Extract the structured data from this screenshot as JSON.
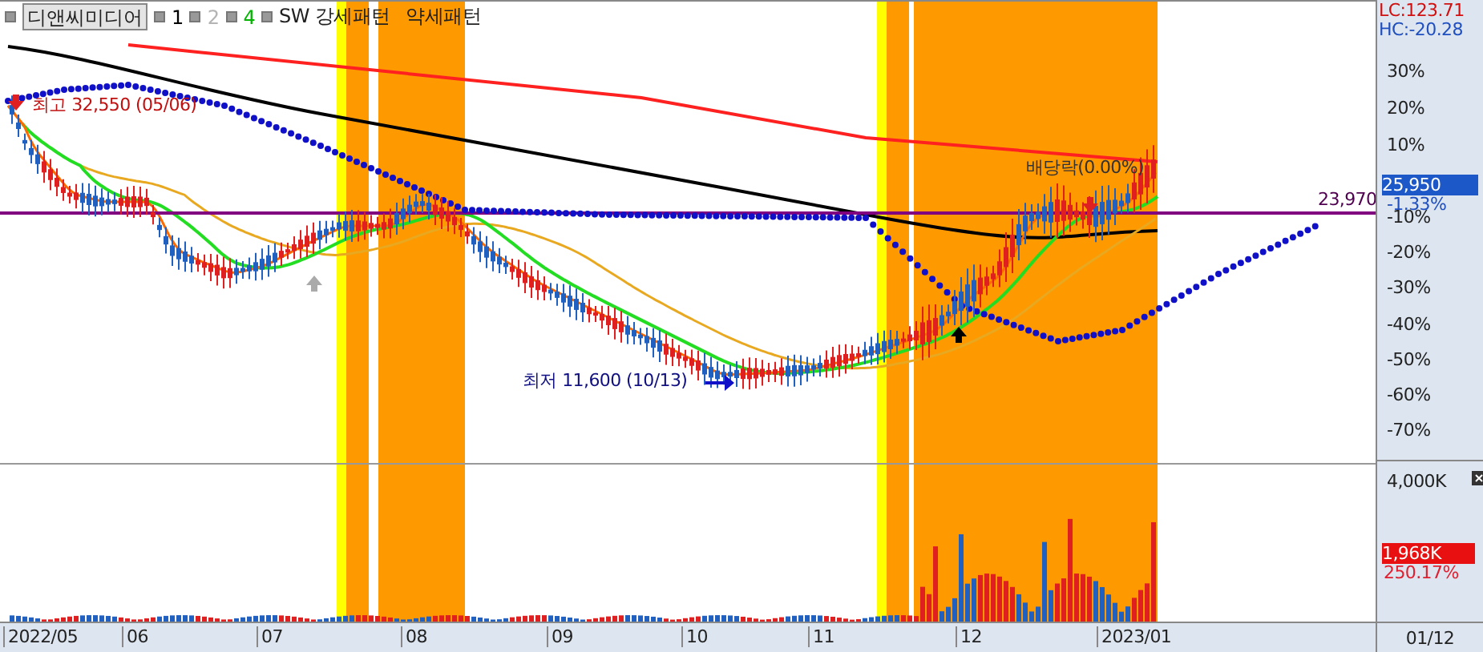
{
  "header": {
    "stock_button": "디앤씨미디어",
    "legend": [
      {
        "label": "1",
        "color": "#000000"
      },
      {
        "label": "2",
        "color": "#b4b4b4"
      },
      {
        "label": "4",
        "color": "#00b400"
      },
      {
        "label": "SW 강세패턴",
        "color": "#202020"
      }
    ],
    "extra_label": "약세패턴"
  },
  "annotations": {
    "high": "최고 32,550 (05/06)",
    "low": "최저 11,600 (10/13)",
    "dividend": "배당락(0.00%)",
    "line_value": "23,970"
  },
  "price_axis": {
    "lc": "LC:123.71",
    "hc": "HC:-20.28",
    "ticks": [
      "30%",
      "20%",
      "10%",
      "-10%",
      "-20%",
      "-30%",
      "-40%",
      "-50%",
      "-60%",
      "-70%"
    ],
    "current_price": "25,950",
    "change": "-1.33%"
  },
  "volume_axis": {
    "tick": "4,000K",
    "current_volume": "1,968K",
    "ratio": "250.17%"
  },
  "time_axis": {
    "labels": [
      "2022/05",
      "06",
      "07",
      "08",
      "09",
      "10",
      "11",
      "12",
      "2023/01"
    ],
    "end_label": "01/12"
  }
}
